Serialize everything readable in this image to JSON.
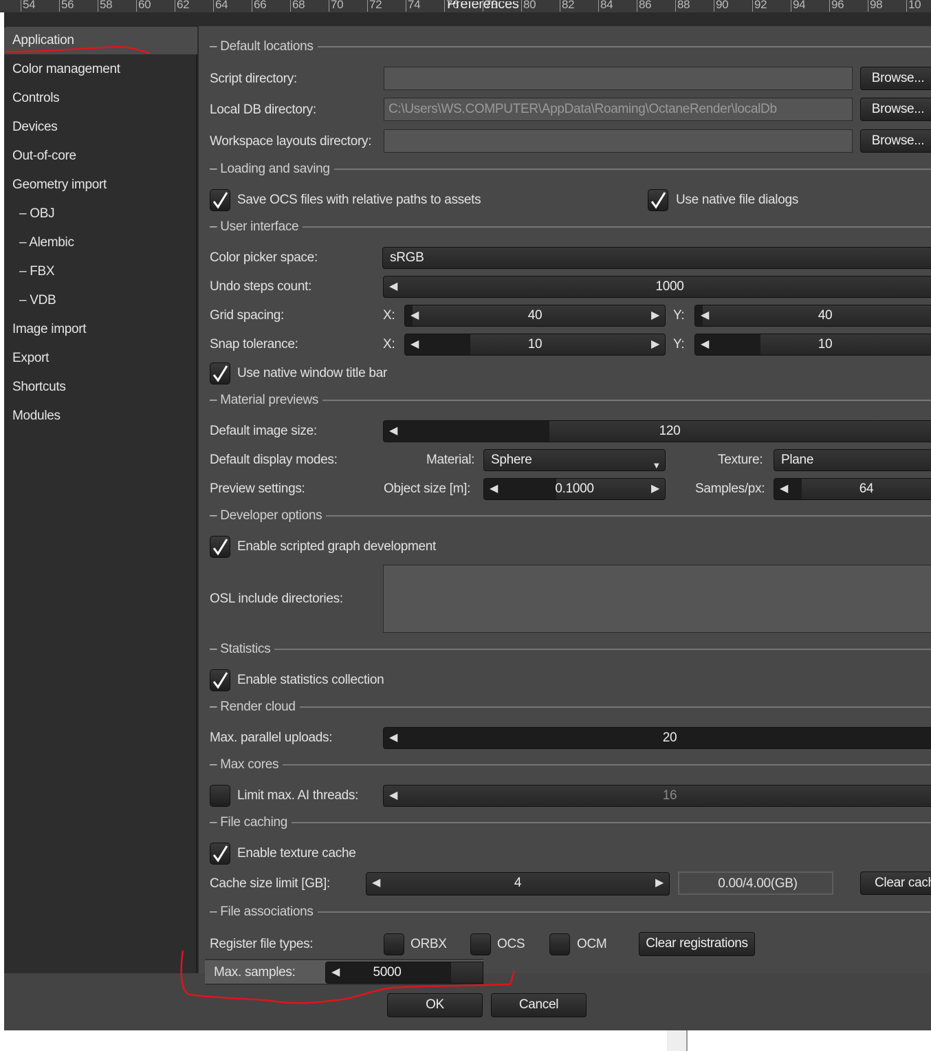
{
  "ruler": [
    "54",
    "56",
    "58",
    "60",
    "62",
    "64",
    "66",
    "68",
    "70",
    "72",
    "74",
    "76",
    "78",
    "80",
    "82",
    "84",
    "86",
    "88",
    "90",
    "92",
    "94",
    "96",
    "98",
    "10"
  ],
  "window_title": "Preferences",
  "sidebar": [
    {
      "label": "Application",
      "selected": true
    },
    {
      "label": "Color management"
    },
    {
      "label": "Controls"
    },
    {
      "label": "Devices"
    },
    {
      "label": "Out-of-core"
    },
    {
      "label": "Geometry import"
    },
    {
      "label": "–  OBJ"
    },
    {
      "label": "–  Alembic"
    },
    {
      "label": "–  FBX"
    },
    {
      "label": "–  VDB"
    },
    {
      "label": "Image import"
    },
    {
      "label": "Export"
    },
    {
      "label": "Shortcuts"
    },
    {
      "label": "Modules"
    }
  ],
  "sections": {
    "default_locations": "– Default locations",
    "loading_saving": "– Loading and saving",
    "user_interface": "– User interface",
    "material_previews": "– Material previews",
    "developer": "– Developer options",
    "statistics": "– Statistics",
    "render_cloud": "– Render cloud",
    "max_cores": "– Max cores",
    "file_caching": "– File caching",
    "file_assoc": "– File associations"
  },
  "browse": "Browse...",
  "script_dir": {
    "label": "Script directory:",
    "value": ""
  },
  "localdb_dir": {
    "label": "Local DB directory:",
    "value": "C:\\Users\\WS.COMPUTER\\AppData\\Roaming\\OctaneRender\\localDb"
  },
  "workspace_dir": {
    "label": "Workspace layouts directory:",
    "value": ""
  },
  "save_ocs": {
    "label": "Save OCS files with relative paths to assets",
    "checked": true
  },
  "native_dialogs": {
    "label": "Use native file dialogs",
    "checked": true
  },
  "color_picker": {
    "label": "Color picker space:",
    "value": "sRGB"
  },
  "undo_steps": {
    "label": "Undo steps count:",
    "value": "1000",
    "fill": 0.0
  },
  "grid_spacing": {
    "label": "Grid spacing:",
    "x_label": "X:",
    "y_label": "Y:",
    "x": "40",
    "y": "40",
    "x_fill": 0.03,
    "y_fill": 0.03
  },
  "snap_tolerance": {
    "label": "Snap tolerance:",
    "x_label": "X:",
    "y_label": "Y:",
    "x": "10",
    "y": "10",
    "x_fill": 0.25,
    "y_fill": 0.25
  },
  "native_titlebar": {
    "label": "Use native window title bar",
    "checked": true
  },
  "default_image_size": {
    "label": "Default image size:",
    "value": "120",
    "fill": 0.29
  },
  "display_modes": {
    "label": "Default display modes:",
    "material_label": "Material:",
    "material": "Sphere",
    "texture_label": "Texture:",
    "texture": "Plane"
  },
  "preview_settings": {
    "label": "Preview settings:",
    "object_size_label": "Object size [m]:",
    "object_size": "0.1000",
    "object_fill": 0.4,
    "samples_label": "Samples/px:",
    "samples": "64",
    "samples_fill": 0.15
  },
  "scripted_graph": {
    "label": "Enable scripted graph development",
    "checked": true
  },
  "osl_dirs": {
    "label": "OSL include directories:",
    "value": ""
  },
  "stats": {
    "label": "Enable statistics collection",
    "checked": true
  },
  "parallel_uploads": {
    "label": "Max. parallel uploads:",
    "value": "20",
    "fill": 1.0
  },
  "ai_threads": {
    "label": "Limit max. AI threads:",
    "value": "16",
    "checked": false
  },
  "texture_cache": {
    "label": "Enable texture cache",
    "checked": true
  },
  "cache_limit": {
    "label": "Cache size limit [GB]:",
    "value": "4",
    "usage": "0.00/4.00(GB)",
    "clear": "Clear cache"
  },
  "register": {
    "label": "Register file types:",
    "types": [
      "ORBX",
      "OCS",
      "OCM"
    ],
    "clear": "Clear registrations"
  },
  "max_samples": {
    "label": "Max. samples:",
    "value": "5000",
    "fill": 1.0
  },
  "ok": "OK",
  "cancel": "Cancel",
  "colors": {
    "annotation": "#e0141e",
    "panel": "#484848",
    "sidebar": "#2d2d2d"
  }
}
